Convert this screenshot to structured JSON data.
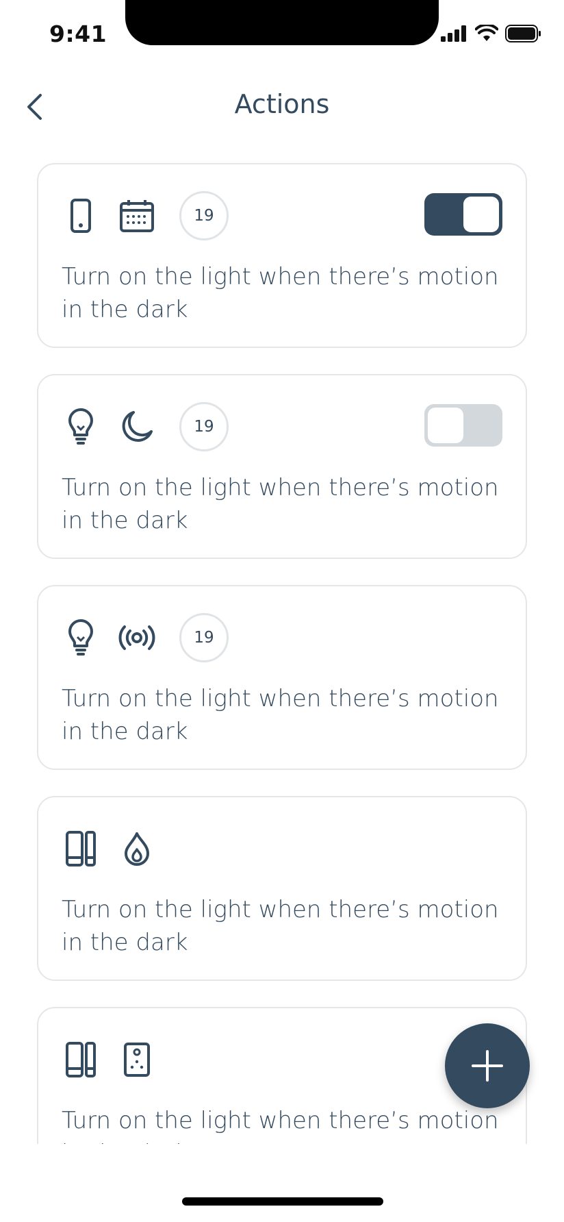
{
  "status_bar": {
    "time": "9:41"
  },
  "nav": {
    "title": "Actions"
  },
  "cards": [
    {
      "icons": [
        "phone-icon",
        "calendar-icon"
      ],
      "badge": "19",
      "toggle": "on",
      "text": "Turn on the light when there’s motion in the dark"
    },
    {
      "icons": [
        "lightbulb-icon",
        "moon-icon"
      ],
      "badge": "19",
      "toggle": "off",
      "text": "Turn on the light when there’s motion in the dark"
    },
    {
      "icons": [
        "lightbulb-icon",
        "broadcast-icon"
      ],
      "badge": "19",
      "text": "Turn on the light when there’s motion in the dark"
    },
    {
      "icons": [
        "door-window-sensor-icon",
        "flame-icon"
      ],
      "text": "Turn on the light when there’s motion in the dark"
    },
    {
      "icons": [
        "door-window-sensor-icon",
        "remote-icon"
      ],
      "text": "Turn on the light when there’s motion in the dark"
    }
  ],
  "colors": {
    "primary": "#344a5f",
    "border": "#e4e7ea",
    "toggle_off": "#d3d8dc"
  }
}
